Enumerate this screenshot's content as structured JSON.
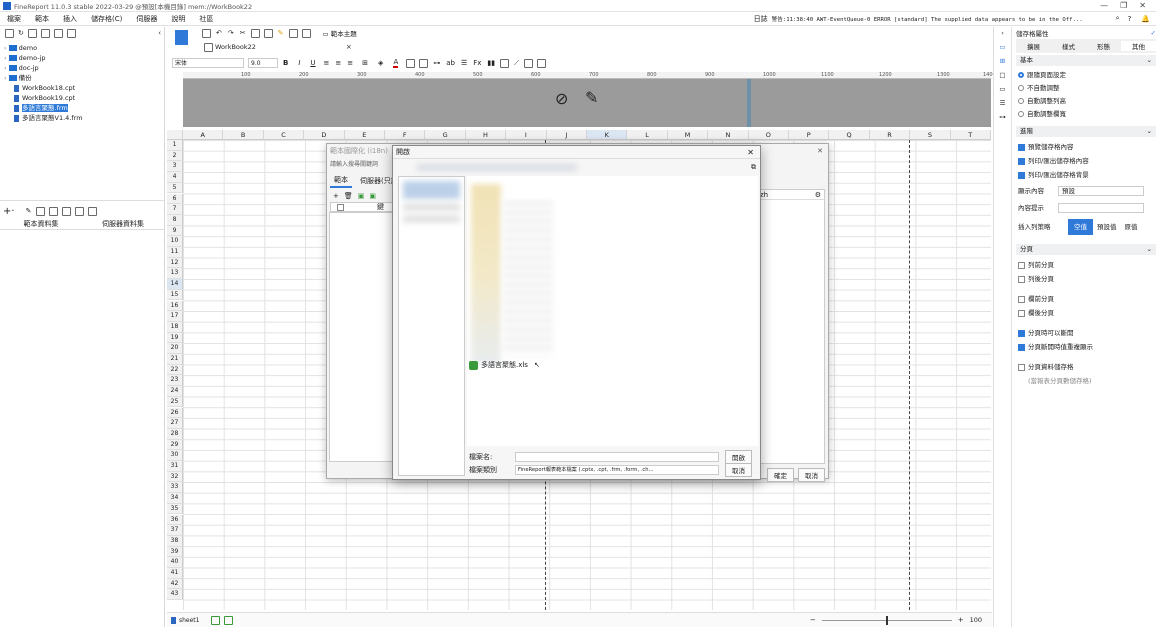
{
  "titlebar": {
    "title": "FineReport 11.0.3 stable 2022-03-29 @預設[本機目錄]   mem://WorkBook22",
    "window_controls": [
      "minimize-icon",
      "restore-icon",
      "close-icon"
    ]
  },
  "menubar": {
    "items": [
      "檔案",
      "範本",
      "插入",
      "儲存格(C)",
      "伺服器",
      "說明",
      "社區"
    ],
    "log_label": "日誌",
    "log_text": "警告:11:38:40 AWT-EventQueue-0 ERROR [standard] The supplied data appears to be in the Off..."
  },
  "left": {
    "tree": [
      {
        "label": "demo",
        "type": "folder"
      },
      {
        "label": "demo-jp",
        "type": "folder"
      },
      {
        "label": "doc-jp",
        "type": "folder"
      },
      {
        "label": "備份",
        "type": "folder"
      },
      {
        "label": "WorkBook18.cpt",
        "type": "file"
      },
      {
        "label": "WorkBook19.cpt",
        "type": "file"
      },
      {
        "label": "多語言聚態.frm",
        "type": "file",
        "selected": true
      },
      {
        "label": "多語言聚態V1.4.frm",
        "type": "file"
      }
    ],
    "tabs": [
      "範本資料集",
      "伺服器資料集"
    ]
  },
  "editor": {
    "tab_label": "WorkBook22",
    "theme_button": "範本主題",
    "font_name": "宋体",
    "font_size": "9.0",
    "columns": [
      "A",
      "B",
      "C",
      "D",
      "E",
      "F",
      "G",
      "H",
      "I",
      "J",
      "K",
      "L",
      "M",
      "N",
      "O",
      "P",
      "Q",
      "R",
      "S",
      "T"
    ],
    "ruler": [
      "100",
      "200",
      "300",
      "400",
      "500",
      "600",
      "700",
      "800",
      "900",
      "1000",
      "1100",
      "1200",
      "1300",
      "1400"
    ],
    "sheet_name": "sheet1",
    "zoom": "100"
  },
  "dialog_i18n": {
    "title": "範本國際化 (i18n)",
    "search_placeholder": "請輸入搜尋關鍵詞",
    "tabs": [
      "範本",
      "伺服器(只讀)"
    ],
    "col_key": "鍵",
    "col_lang": "zh",
    "ok": "確定",
    "cancel": "取消"
  },
  "dialog_open": {
    "title": "開啟",
    "file_item": "多語言聚態.xls",
    "filename_label": "檔案名:",
    "filename_value": "",
    "filetype_label": "檔案類別",
    "filetype_value": "FineReport報表範本檔案 (.cptx, .cpt, .frm, .form, .ch...",
    "open_button": "開啟",
    "cancel_button": "取消"
  },
  "right": {
    "title": "儲存格屬性",
    "tabs": [
      "擴展",
      "樣式",
      "形態",
      "其他"
    ],
    "basic_section": "基本",
    "radios": [
      {
        "label": "跟隨頁面設定",
        "on": true
      },
      {
        "label": "不自動調整",
        "on": false
      },
      {
        "label": "自動調整列高",
        "on": false
      },
      {
        "label": "自動調整欄寬",
        "on": false
      }
    ],
    "advanced_section": "進階",
    "adv_checks": [
      {
        "label": "預覽儲存格內容",
        "on": true
      },
      {
        "label": "列印/匯出儲存格內容",
        "on": true
      },
      {
        "label": "列印/匯出儲存格背景",
        "on": true
      }
    ],
    "display_label": "顯示內容",
    "display_value": "預設",
    "tooltip_label": "內容提示",
    "insert_label": "插入列策略",
    "insert_options": [
      "空值",
      "預設值",
      "原值"
    ],
    "page_section": "分頁",
    "page_checks": [
      {
        "label": "列前分頁",
        "on": false
      },
      {
        "label": "列後分頁",
        "on": false
      },
      {
        "label": "欄前分頁",
        "on": false
      },
      {
        "label": "欄後分頁",
        "on": false
      },
      {
        "label": "分頁時可以斷開",
        "on": true
      },
      {
        "label": "分頁斷開時值重複顯示",
        "on": true
      },
      {
        "label": "分頁資料儲存格",
        "on": false
      }
    ],
    "page_note": "(當報表分頁數儲存格)"
  },
  "colors": {
    "accent": "#2f7ad8",
    "design_bar": "#9b9b9b"
  }
}
